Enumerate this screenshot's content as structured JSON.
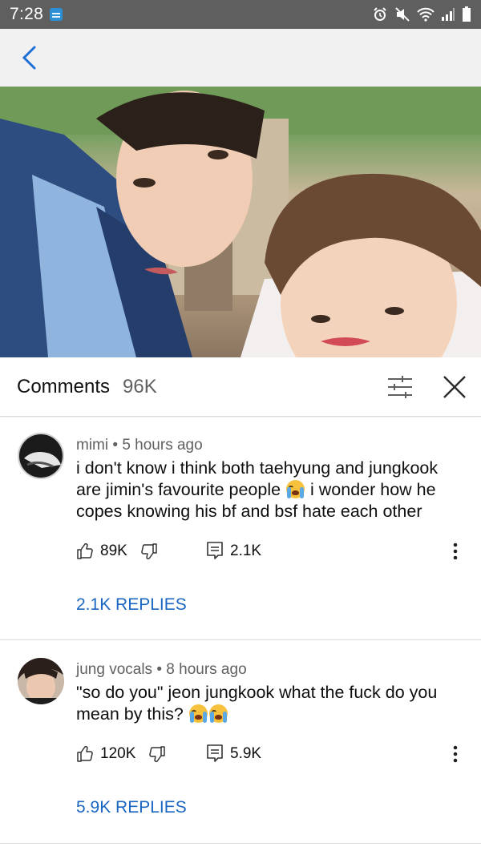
{
  "status_bar": {
    "time": "7:28"
  },
  "comments_header": {
    "title": "Comments",
    "count": "96K"
  },
  "comments": [
    {
      "author": "mimi",
      "time": "5 hours ago",
      "text_before_emoji": "i don't know i think both taehyung and jungkook are jimin's favourite people ",
      "text_after_emoji": " i wonder how he copes knowing his bf and bsf hate each other",
      "emoji": "loudly-crying-face",
      "likes": "89K",
      "replies_count": "2.1K",
      "replies_label": "2.1K REPLIES"
    },
    {
      "author": "jung vocals",
      "time": "8 hours ago",
      "text_before_emoji": "\"so do you\" jeon jungkook what the fuck do you mean by this? ",
      "text_after_emoji": "",
      "emoji": "loudly-crying-face x2",
      "likes": "120K",
      "replies_count": "5.9K",
      "replies_label": "5.9K REPLIES"
    }
  ],
  "colors": {
    "accent": "#1a66c2",
    "status_bar": "#5f5f5f",
    "app_bar": "#f1f1f1",
    "secondary_text": "#606060"
  }
}
